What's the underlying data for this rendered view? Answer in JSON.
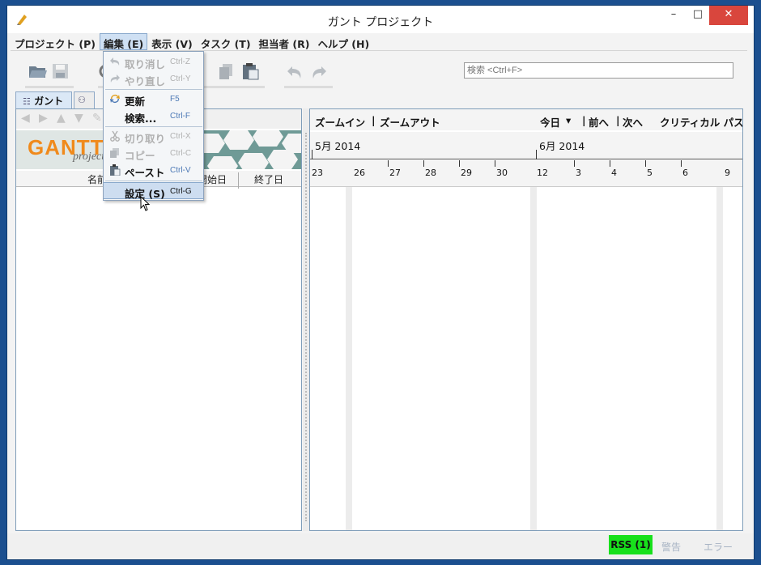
{
  "window": {
    "title": "ガント プロジェクト",
    "minimize": "–",
    "maximize": "□",
    "close": "✕"
  },
  "menubar": [
    {
      "label": "プロジェクト (P)"
    },
    {
      "label": "編集 (E)"
    },
    {
      "label": "表示 (V)"
    },
    {
      "label": "タスク (T)"
    },
    {
      "label": "担当者 (R)"
    },
    {
      "label": "ヘルプ (H)"
    }
  ],
  "search": {
    "placeholder": "検索 <Ctrl+F>"
  },
  "tabs": {
    "gantt": "ガント"
  },
  "banner": {
    "logo": "GANTT",
    "sub": "project"
  },
  "table": {
    "col_name": "名前",
    "col_start": "開始日",
    "col_end": "終了日"
  },
  "chart_toolbar": {
    "zoom_in": "ズームイン",
    "sep": "|",
    "zoom_out": "ズームアウト",
    "today": "今日",
    "prev": "前へ",
    "next": "次へ",
    "critical": "クリティカル パス"
  },
  "months": [
    "5月 2014",
    "6月 2014"
  ],
  "days": [
    "23",
    "26",
    "27",
    "28",
    "29",
    "30",
    "12",
    "3",
    "4",
    "5",
    "6",
    "9"
  ],
  "edit_menu": {
    "undo": {
      "label": "取り消し",
      "shortcut": "Ctrl-Z"
    },
    "redo": {
      "label": "やり直し",
      "shortcut": "Ctrl-Y"
    },
    "refresh": {
      "label": "更新",
      "shortcut": "F5"
    },
    "search": {
      "label": "検索...",
      "shortcut": "Ctrl-F"
    },
    "cut": {
      "label": "切り取り",
      "shortcut": "Ctrl-X"
    },
    "copy": {
      "label": "コピー",
      "shortcut": "Ctrl-C"
    },
    "paste": {
      "label": "ペースト",
      "shortcut": "Ctrl-V"
    },
    "settings": {
      "label": "設定 (S)",
      "shortcut": "Ctrl-G"
    }
  },
  "statusbar": {
    "rss": "RSS (1)",
    "warning": "警告",
    "error": "エラー"
  },
  "colors": {
    "accent": "#cfe0f3",
    "rss": "#18e01c",
    "close": "#d9463d",
    "logo": "#f08a1c"
  }
}
